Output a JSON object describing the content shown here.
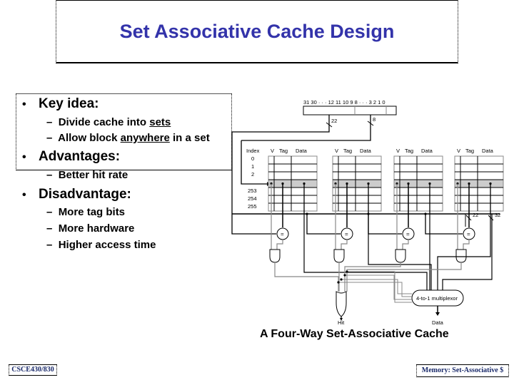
{
  "title": "Set Associative Cache Design",
  "bullets": [
    {
      "label": "Key idea:",
      "items": [
        {
          "prefix": "Divide cache into ",
          "underlined": "sets",
          "suffix": ""
        },
        {
          "prefix": "Allow block ",
          "underlined": "anywhere",
          "suffix": " in a set"
        }
      ]
    },
    {
      "label": "Advantages:",
      "items": [
        {
          "prefix": "Better hit rate",
          "underlined": "",
          "suffix": ""
        }
      ]
    },
    {
      "label": "Disadvantage:",
      "items": [
        {
          "prefix": "More tag bits",
          "underlined": "",
          "suffix": ""
        },
        {
          "prefix": "More hardware",
          "underlined": "",
          "suffix": ""
        },
        {
          "prefix": "Higher access time",
          "underlined": "",
          "suffix": ""
        }
      ]
    }
  ],
  "bullet_glyph": "•",
  "dash_glyph": "–",
  "diagram": {
    "address_bits_label": "31 30 · · · 12 11 10 9 8 · · · 3 2 1 0",
    "tag_width": "22",
    "index_width": "8",
    "index_header": "Index",
    "index_rows_top": [
      "0",
      "1",
      "2"
    ],
    "index_rows_bottom": [
      "253",
      "254",
      "255"
    ],
    "column_headers": [
      "V",
      "Tag",
      "Data"
    ],
    "ways": 4,
    "comparator_symbol": "=",
    "bus_tag_width": "22",
    "bus_data_width": "32",
    "mux_label": "4-to-1 multiplexor",
    "hit_label": "Hit",
    "data_label": "Data",
    "colors": {
      "selected_row": "#cccccc",
      "gray_wire": "#888888",
      "black_wire": "#000000"
    }
  },
  "caption": "A Four-Way Set-Associative Cache",
  "footer": {
    "left": "CSCE430/830",
    "right": "Memory: Set-Associative $"
  },
  "colors": {
    "title": "#3333aa",
    "footer_text": "#1a2a6a"
  }
}
